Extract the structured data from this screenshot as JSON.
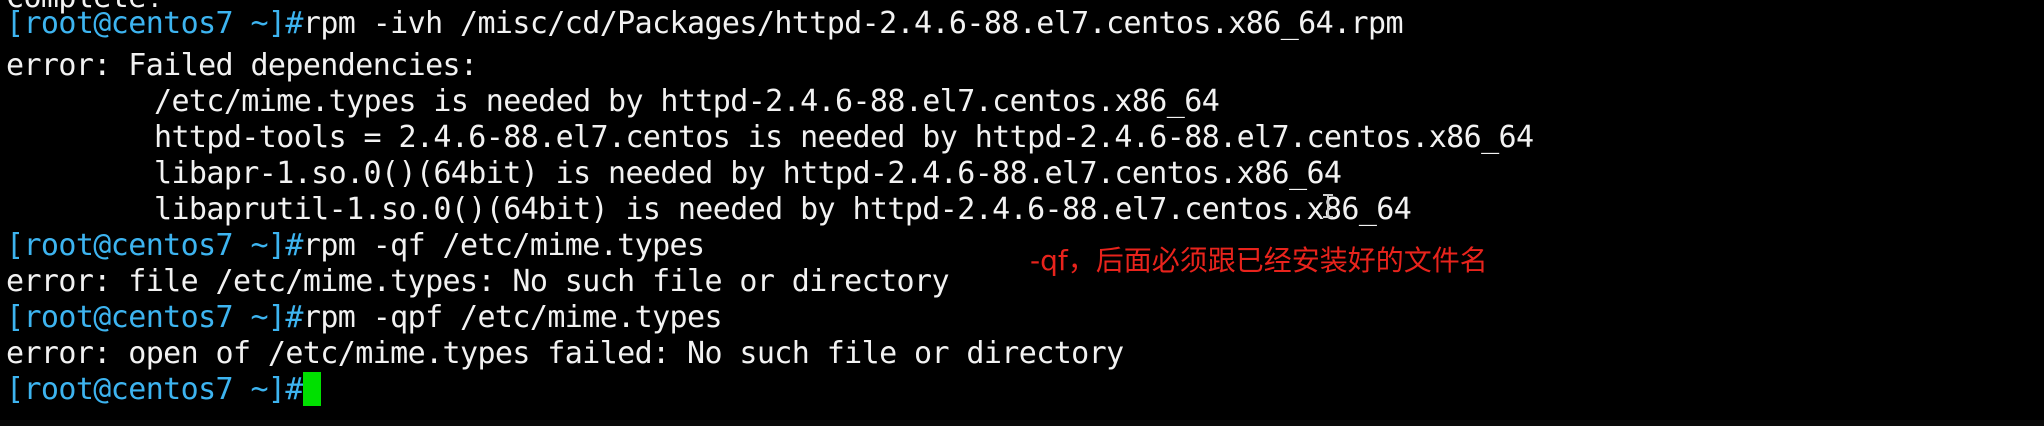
{
  "terminal": {
    "lines": [
      {
        "kind": "output",
        "text": "Complete!"
      },
      {
        "kind": "command",
        "prompt": "[root@centos7 ~]#",
        "text": "rpm -ivh /misc/cd/Packages/httpd-2.4.6-88.el7.centos.x86_64.rpm"
      },
      {
        "kind": "output",
        "text": "error: Failed dependencies:"
      },
      {
        "kind": "output",
        "text": "/etc/mime.types is needed by httpd-2.4.6-88.el7.centos.x86_64"
      },
      {
        "kind": "output",
        "text": "httpd-tools = 2.4.6-88.el7.centos is needed by httpd-2.4.6-88.el7.centos.x86_64"
      },
      {
        "kind": "output",
        "text": "libapr-1.so.0()(64bit) is needed by httpd-2.4.6-88.el7.centos.x86_64"
      },
      {
        "kind": "output",
        "text": "libaprutil-1.so.0()(64bit) is needed by httpd-2.4.6-88.el7.centos.x86_64"
      },
      {
        "kind": "command",
        "prompt": "[root@centos7 ~]#",
        "text": "rpm -qf /etc/mime.types"
      },
      {
        "kind": "output",
        "text": "error: file /etc/mime.types: No such file or directory"
      },
      {
        "kind": "command",
        "prompt": "[root@centos7 ~]#",
        "text": "rpm -qpf /etc/mime.types"
      },
      {
        "kind": "output",
        "text": "error: open of /etc/mime.types failed: No such file or directory"
      },
      {
        "kind": "command",
        "prompt": "[root@centos7 ~]#",
        "text": ""
      }
    ],
    "annotation": "-qf，后面必须跟已经安装好的文件名",
    "colors": {
      "background": "#000000",
      "text": "#f2f2f2",
      "prompt": "#3db4f0",
      "cursor": "#00e000",
      "annotation": "#e8231c"
    },
    "cursor_icon": "text-cursor-icon"
  }
}
